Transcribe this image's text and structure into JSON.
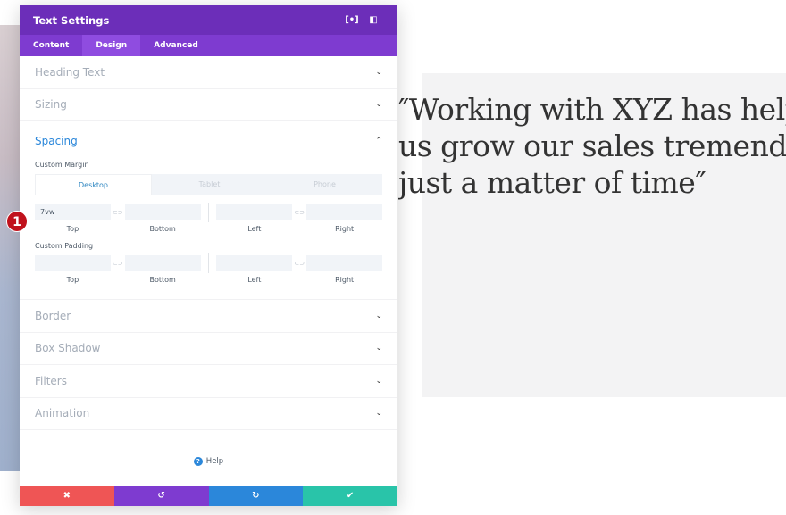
{
  "page": {
    "quote_lines": [
      "″Working with XYZ has help",
      "us grow our sales tremendousl",
      "just a matter of time″"
    ]
  },
  "panel": {
    "title": "Text Settings",
    "header_icons": [
      "focus-icon",
      "sidebar-toggle-icon"
    ],
    "tabs": [
      {
        "label": "Content"
      },
      {
        "label": "Design",
        "active": true
      },
      {
        "label": "Advanced"
      }
    ],
    "sections_top": [
      {
        "label": "Heading Text"
      },
      {
        "label": "Sizing"
      }
    ],
    "spacing": {
      "label": "Spacing",
      "custom_margin": "Custom Margin",
      "custom_padding": "Custom Padding",
      "devices": [
        "Desktop",
        "Tablet",
        "Phone"
      ],
      "margin": {
        "top": "7vw",
        "bottom": "",
        "left": "",
        "right": ""
      },
      "captions": {
        "top": "Top",
        "bottom": "Bottom",
        "left": "Left",
        "right": "Right"
      }
    },
    "sections_bottom": [
      {
        "label": "Border"
      },
      {
        "label": "Box Shadow"
      },
      {
        "label": "Filters"
      },
      {
        "label": "Animation"
      }
    ],
    "help": "Help",
    "footer_colors": {
      "cancel": "#ef5555",
      "undo": "#7e3bd0",
      "redo": "#2b87da",
      "save": "#29c4a9"
    }
  },
  "annotation": {
    "step": "1"
  },
  "colors": {
    "header": "#6c2eb9",
    "tabs": "#7e3bd0",
    "accent": "#2b87da"
  }
}
